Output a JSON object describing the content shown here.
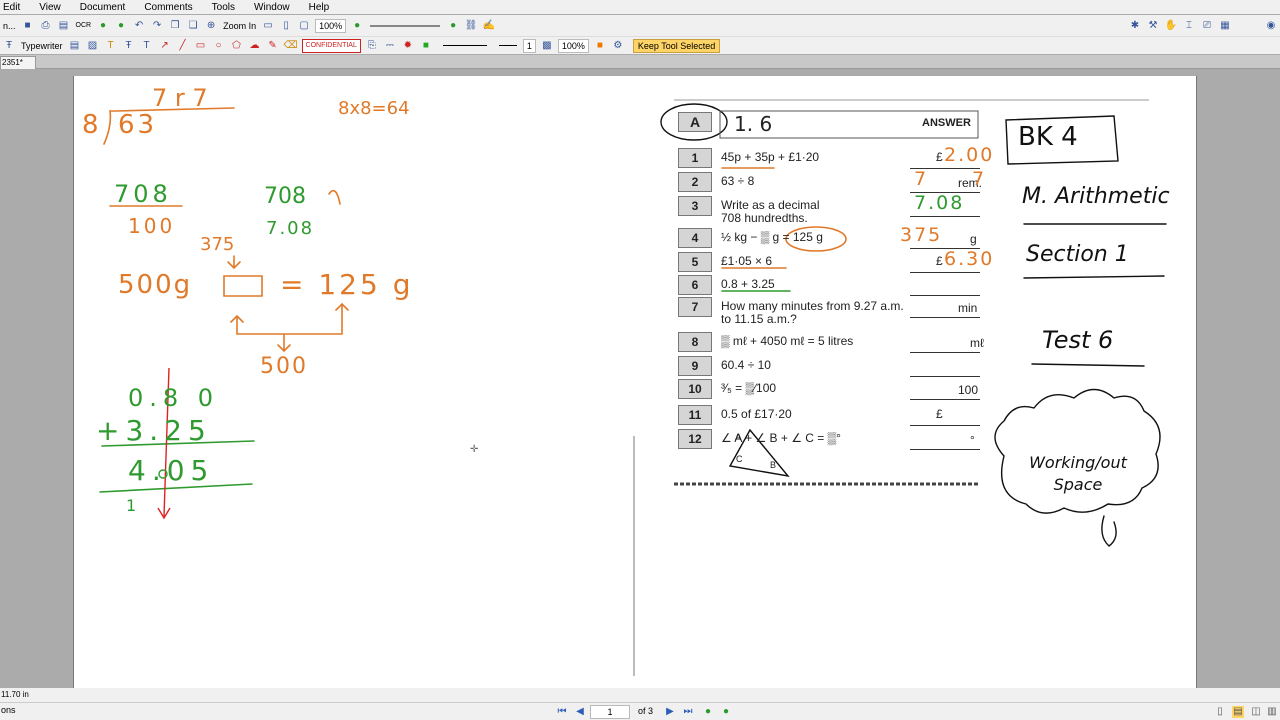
{
  "menu": [
    "Edit",
    "View",
    "Document",
    "Comments",
    "Tools",
    "Window",
    "Help"
  ],
  "toolbar": {
    "open_label": "n...",
    "ocr_label": "OCR",
    "zoom_in_label": "Zoom In",
    "zoom_value": "100%"
  },
  "comment_toolbar": {
    "typewriter_label": "Typewriter",
    "stamp_label": "CONFIDENTIAL",
    "line_width": "1",
    "opacity": "100%",
    "keep_tool_label": "Keep Tool Selected"
  },
  "tab": {
    "label": "2351*"
  },
  "handwriting_left": {
    "division_divisor": "8",
    "division_dividend": "63",
    "division_result": "7 r 7",
    "multiply": "8x8=64",
    "fraction_top": "708",
    "fraction_bottom": "100",
    "fraction_decimal_top": "708",
    "fraction_decimal": "7.08",
    "value_375": "375",
    "weight_left": "500g",
    "equals_value": "= 125 g",
    "value_500": "500",
    "add_row1": "0.8 0",
    "add_row2": "+3.25",
    "add_sum": "4.05",
    "carry": "1"
  },
  "worksheet": {
    "test_label": "A",
    "test_number": "1. 6",
    "answer_header": "ANSWER",
    "questions": [
      {
        "num": "1",
        "text": "45p + 35p + £1·20",
        "prefix": "£",
        "answer": "2.00"
      },
      {
        "num": "2",
        "text": "63 ÷ 8",
        "answer": "7",
        "suffix": "rem.",
        "answer2": "7"
      },
      {
        "num": "3",
        "text": "Write as a decimal",
        "text2": "708 hundredths.",
        "answer": "7.08"
      },
      {
        "num": "4",
        "text": "½ kg − ▒ g = 125 g",
        "answer": "375",
        "suffix": "g"
      },
      {
        "num": "5",
        "text": "£1·05 × 6",
        "prefix": "£",
        "answer": "6.30"
      },
      {
        "num": "6",
        "text": "0.8 + 3.25"
      },
      {
        "num": "7",
        "text": "How many minutes from 9.27 a.m.",
        "text2": "to 11.15 a.m.?",
        "suffix": "min"
      },
      {
        "num": "8",
        "text": "▒ mℓ + 4050 mℓ = 5 litres",
        "suffix": "mℓ"
      },
      {
        "num": "9",
        "text": "60.4 ÷ 10"
      },
      {
        "num": "10",
        "text": "³⁄₅ = ▒⁄100",
        "suffix": "100"
      },
      {
        "num": "11",
        "text": "0.5 of £17·20",
        "prefix": "£"
      },
      {
        "num": "12",
        "text": "∠ A + ∠ B + ∠ C = ▒°",
        "suffix": "°"
      }
    ],
    "triangle_labels": [
      "A",
      "C",
      "B"
    ]
  },
  "handwriting_right": {
    "book": "BK 4",
    "subject": "M. Arithmetic",
    "section": "Section 1",
    "test": "Test 6",
    "cloud": "Working/out Space"
  },
  "status": {
    "size": "11.70 in",
    "options": "ons"
  },
  "nav": {
    "page_current": "1",
    "page_total": "of 3"
  }
}
